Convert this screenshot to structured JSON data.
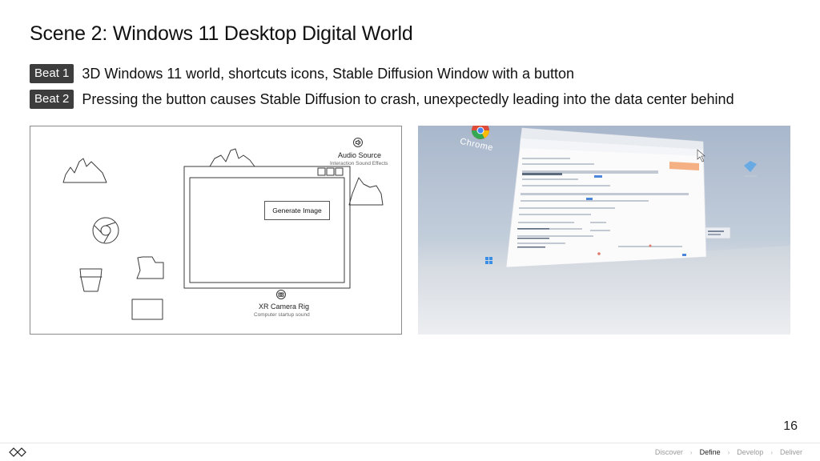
{
  "slide": {
    "title": "Scene 2: Windows 11 Desktop Digital World",
    "page_number": "16"
  },
  "beats": [
    {
      "tag": "Beat 1",
      "text": "3D Windows 11 world, shortcuts icons, Stable Diffusion Window with a button"
    },
    {
      "tag": "Beat 2",
      "text": "Pressing the button causes Stable Diffusion to crash, unexpectedly leading into the data center behind"
    }
  ],
  "wireframe": {
    "audio_source_label": "Audio Source",
    "audio_source_sub": "Interaction Sound Effects",
    "button_label": "Generate Image",
    "camera_label": "XR Camera Rig",
    "camera_sub": "Computer startup sound"
  },
  "render": {
    "chrome_icon_label": "Chrome"
  },
  "footer": {
    "nav": [
      "Discover",
      "Define",
      "Develop",
      "Deliver"
    ],
    "active": "Define"
  }
}
